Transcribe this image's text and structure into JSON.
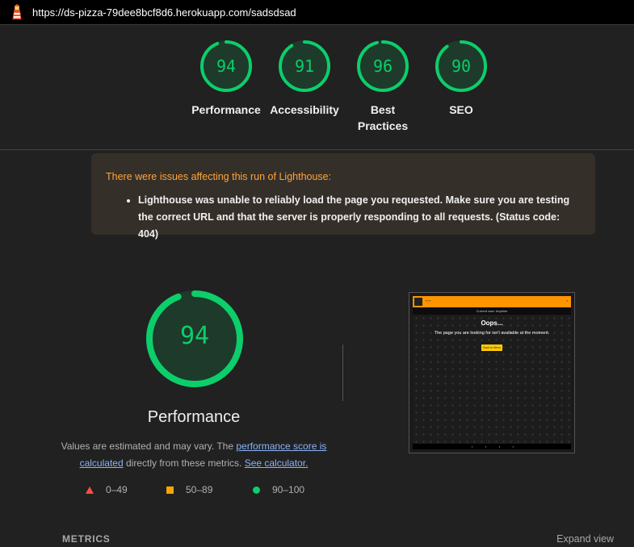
{
  "topbar": {
    "url": "https://ds-pizza-79dee8bcf8d6.herokuapp.com/sadsdsad",
    "logo_icon": "lighthouse-icon"
  },
  "gauges": [
    {
      "score": "94",
      "label": "Performance",
      "value": 0.94
    },
    {
      "score": "91",
      "label": "Accessibility",
      "value": 0.91
    },
    {
      "score": "96",
      "label": "Best Practices",
      "value": 0.96
    },
    {
      "score": "90",
      "label": "SEO",
      "value": 0.9
    }
  ],
  "warning": {
    "title": "There were issues affecting this run of Lighthouse:",
    "items": [
      "Lighthouse was unable to reliably load the page you requested. Make sure you are testing the correct URL and that the server is properly responding to all requests. (Status code: 404)"
    ]
  },
  "main_gauge": {
    "score": "94",
    "label": "Performance",
    "value": 0.94
  },
  "description": {
    "prefix": "Values are estimated and may vary. The ",
    "link1": "performance score is calculated",
    "middle": " directly from these metrics. ",
    "link2": "See calculator."
  },
  "legend": [
    {
      "range": "0–49",
      "icon": "triangle-icon",
      "color": "#ff4e42"
    },
    {
      "range": "50–89",
      "icon": "square-icon",
      "color": "#ffa400"
    },
    {
      "range": "90–100",
      "icon": "circle-icon",
      "color": "#0cce6b"
    }
  ],
  "thumbnail": {
    "subbar": "Current user: Anytime",
    "title": "Oops...",
    "message": "The page you are looking for isn't available at the moment.",
    "button": "Back to Menu"
  },
  "metrics": {
    "title": "METRICS",
    "expand": "Expand view"
  },
  "colors": {
    "pass": "#0cce6b",
    "warning_text": "#ffa33a",
    "background": "#212121"
  }
}
